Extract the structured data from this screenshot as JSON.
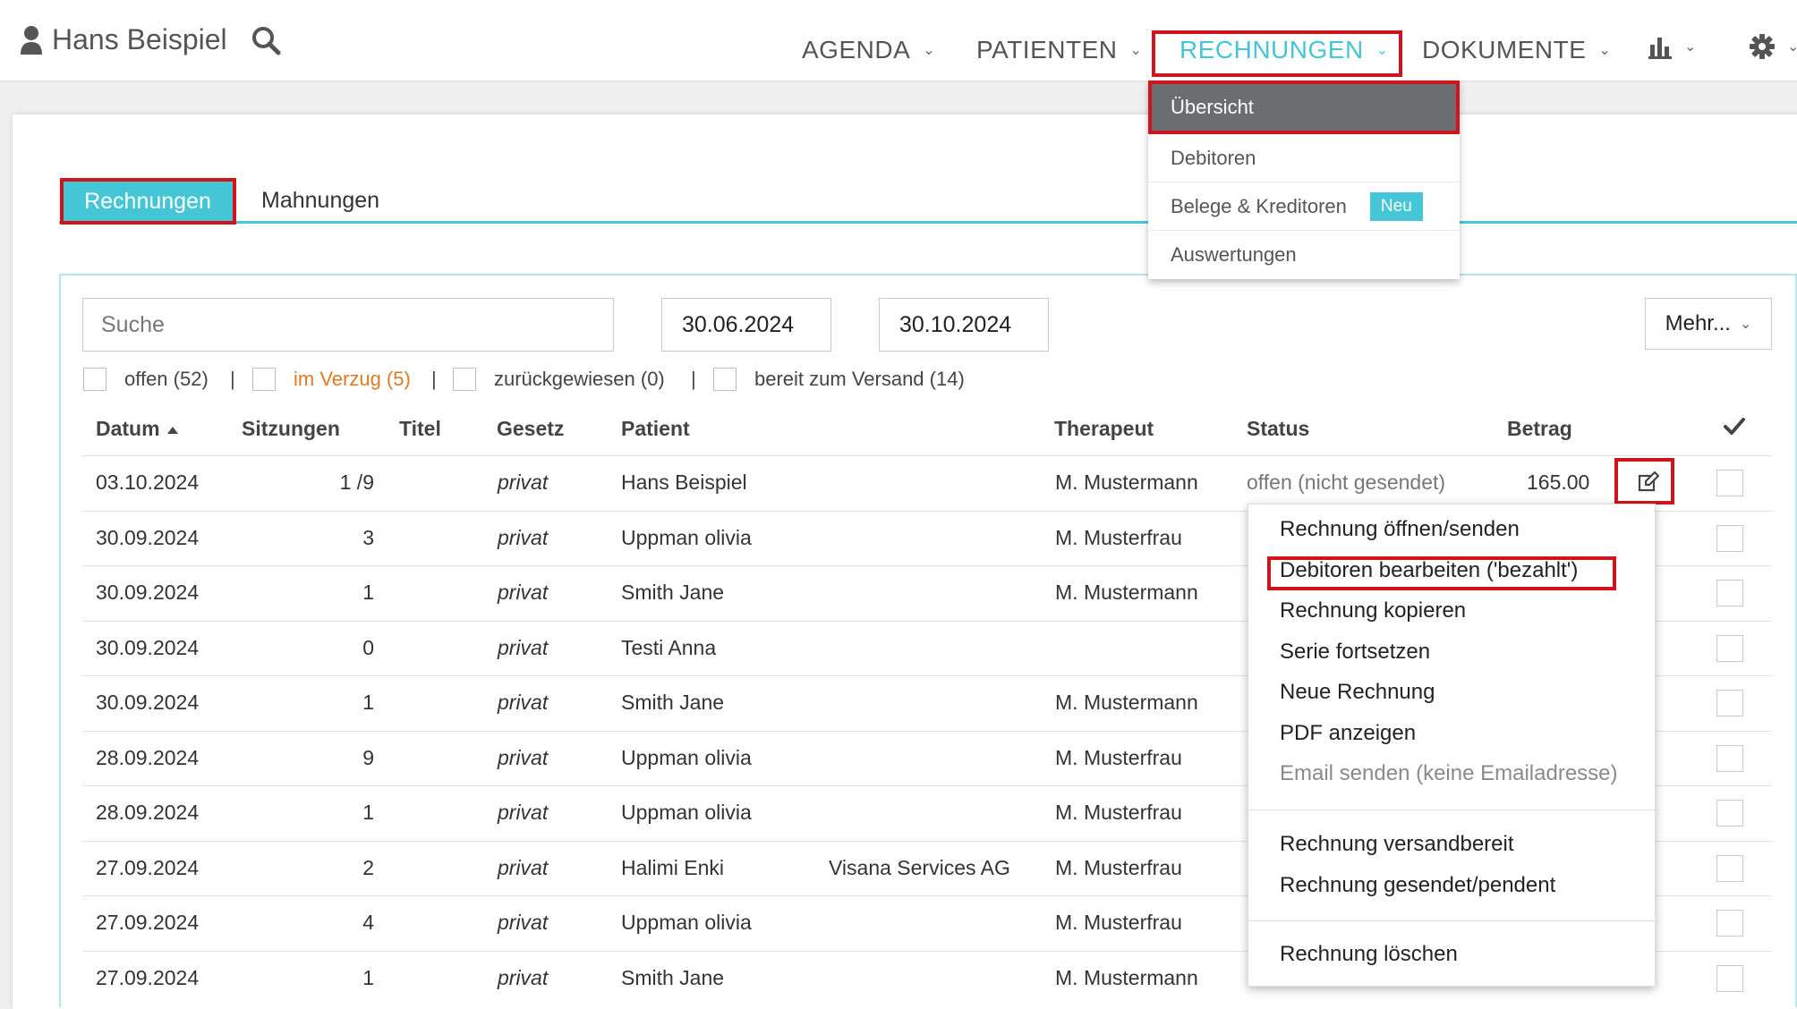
{
  "header": {
    "user_name": "Hans Beispiel",
    "nav": [
      {
        "label": "AGENDA"
      },
      {
        "label": "PATIENTEN"
      },
      {
        "label": "RECHNUNGEN"
      },
      {
        "label": "DOKUMENTE"
      }
    ],
    "icons": [
      "user-icon",
      "search-icon",
      "bar-chart-icon",
      "gear-icon"
    ]
  },
  "rechnungen_menu": {
    "items": [
      {
        "label": "Übersicht"
      },
      {
        "label": "Debitoren"
      },
      {
        "label": "Belege & Kreditoren",
        "badge": "Neu"
      },
      {
        "label": "Auswertungen"
      }
    ]
  },
  "tabs": {
    "active": "Rechnungen",
    "other": "Mahnungen"
  },
  "filters": {
    "search_placeholder": "Suche",
    "date_from": "30.06.2024",
    "date_to": "30.10.2024",
    "more_label": "Mehr...",
    "status_filters": [
      {
        "label": "offen (52)"
      },
      {
        "label": "im Verzug (5)"
      },
      {
        "label": "zurückgewiesen (0)"
      },
      {
        "label": "bereit zum Versand (14)"
      }
    ],
    "separator": "|"
  },
  "table": {
    "headers": {
      "datum": "Datum",
      "sitzungen": "Sitzungen",
      "titel": "Titel",
      "gesetz": "Gesetz",
      "patient": "Patient",
      "therapeut": "Therapeut",
      "status": "Status",
      "betrag": "Betrag"
    },
    "rows": [
      {
        "datum": "03.10.2024",
        "sitzungen": "1 /9",
        "titel": "",
        "gesetz": "privat",
        "patient": "Hans Beispiel",
        "versicherer": "",
        "therapeut": "M. Mustermann",
        "status": "offen (nicht gesendet)",
        "betrag": "165.00"
      },
      {
        "datum": "30.09.2024",
        "sitzungen": "3",
        "titel": "",
        "gesetz": "privat",
        "patient": "Uppman olivia",
        "versicherer": "",
        "therapeut": "M. Musterfrau",
        "status": "",
        "betrag": ""
      },
      {
        "datum": "30.09.2024",
        "sitzungen": "1",
        "titel": "",
        "gesetz": "privat",
        "patient": "Smith Jane",
        "versicherer": "",
        "therapeut": "M. Mustermann",
        "status": "",
        "betrag": ""
      },
      {
        "datum": "30.09.2024",
        "sitzungen": "0",
        "titel": "",
        "gesetz": "privat",
        "patient": "Testi Anna",
        "versicherer": "",
        "therapeut": "",
        "status": "",
        "betrag": ""
      },
      {
        "datum": "30.09.2024",
        "sitzungen": "1",
        "titel": "",
        "gesetz": "privat",
        "patient": "Smith Jane",
        "versicherer": "",
        "therapeut": "M. Mustermann",
        "status": "",
        "betrag": ""
      },
      {
        "datum": "28.09.2024",
        "sitzungen": "9",
        "titel": "",
        "gesetz": "privat",
        "patient": "Uppman olivia",
        "versicherer": "",
        "therapeut": "M. Musterfrau",
        "status": "",
        "betrag": ""
      },
      {
        "datum": "28.09.2024",
        "sitzungen": "1",
        "titel": "",
        "gesetz": "privat",
        "patient": "Uppman olivia",
        "versicherer": "",
        "therapeut": "M. Musterfrau",
        "status": "",
        "betrag": ""
      },
      {
        "datum": "27.09.2024",
        "sitzungen": "2",
        "titel": "",
        "gesetz": "privat",
        "patient": "Halimi Enki",
        "versicherer": "Visana Services AG",
        "therapeut": "M. Musterfrau",
        "status": "",
        "betrag": ""
      },
      {
        "datum": "27.09.2024",
        "sitzungen": "4",
        "titel": "",
        "gesetz": "privat",
        "patient": "Uppman olivia",
        "versicherer": "",
        "therapeut": "M. Musterfrau",
        "status": "",
        "betrag": ""
      },
      {
        "datum": "27.09.2024",
        "sitzungen": "1",
        "titel": "",
        "gesetz": "privat",
        "patient": "Smith Jane",
        "versicherer": "",
        "therapeut": "M. Mustermann",
        "status": "",
        "betrag": ""
      }
    ]
  },
  "context_menu": {
    "items": [
      {
        "label": "Rechnung öffnen/senden",
        "enabled": true
      },
      {
        "label": "Debitoren bearbeiten ('bezahlt')",
        "enabled": true
      },
      {
        "label": "Rechnung kopieren",
        "enabled": true
      },
      {
        "label": "Serie fortsetzen",
        "enabled": true
      },
      {
        "label": "Neue Rechnung",
        "enabled": true
      },
      {
        "label": "PDF anzeigen",
        "enabled": true
      },
      {
        "label": "Email senden (keine Emailadresse)",
        "enabled": false
      },
      {
        "label": "Rechnung versandbereit",
        "enabled": true
      },
      {
        "label": "Rechnung gesendet/pendent",
        "enabled": true
      },
      {
        "label": "Rechnung löschen",
        "enabled": true
      }
    ]
  },
  "colors": {
    "accent": "#45c6d6",
    "highlight": "#d0141e",
    "warning": "#e07b22",
    "menu_selected": "#6b6e70"
  }
}
